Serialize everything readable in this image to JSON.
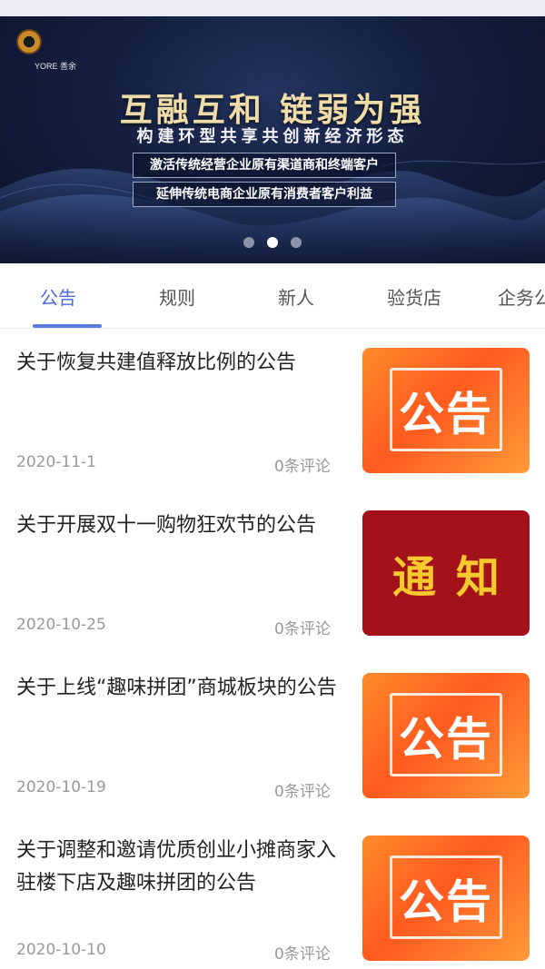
{
  "banner": {
    "logo_text": "YORE 善余",
    "headline": "互融互和 链弱为强",
    "subline": "构建环型共享共创新经济形态",
    "promo_lines": [
      "激活传统经营企业原有渠道商和终端客户",
      "延伸传统电商企业原有消费者客户利益"
    ],
    "carousel_active_index": 1,
    "carousel_count": 3
  },
  "tabs": [
    {
      "label": "公告",
      "active": true
    },
    {
      "label": "规则",
      "active": false
    },
    {
      "label": "新人",
      "active": false
    },
    {
      "label": "验货店",
      "active": false
    },
    {
      "label": "企务公",
      "active": false
    }
  ],
  "articles": [
    {
      "title": "关于恢复共建值释放比例的公告",
      "date": "2020-11-1",
      "comments": "0条评论",
      "thumb_label": "公告",
      "thumb_type": "notice"
    },
    {
      "title": "关于开展双十一购物狂欢节的公告",
      "date": "2020-10-25",
      "comments": "0条评论",
      "thumb_label": "通知",
      "thumb_type": "inform"
    },
    {
      "title": "关于上线“趣味拼团”商城板块的公告",
      "date": "2020-10-19",
      "comments": "0条评论",
      "thumb_label": "公告",
      "thumb_type": "notice"
    },
    {
      "title": "关于调整和邀请优质创业小摊商家入驻楼下店及趣味拼团的公告",
      "date": "2020-10-10",
      "comments": "0条评论",
      "thumb_label": "公告",
      "thumb_type": "notice"
    }
  ],
  "colors": {
    "accent": "#4a68d8",
    "banner_bg": "#141f3f",
    "notice_orange": "#ff5a1f",
    "inform_red": "#a3121a",
    "inform_text": "#f6c92e"
  }
}
